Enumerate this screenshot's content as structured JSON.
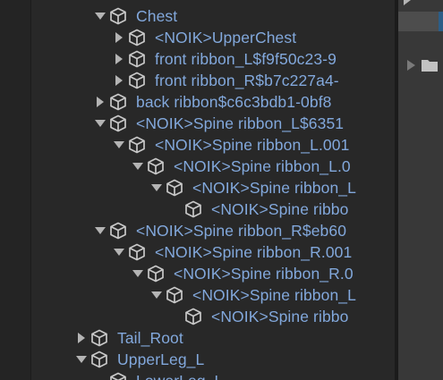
{
  "hierarchy": {
    "rows": [
      {
        "label": "Chest",
        "depth": 1,
        "arrow": "expanded"
      },
      {
        "label": "<NOIK>UpperChest",
        "depth": 2,
        "arrow": "collapsed"
      },
      {
        "label": "front ribbon_L$f9f50c23-9",
        "depth": 2,
        "arrow": "collapsed"
      },
      {
        "label": "front ribbon_R$b7c227a4-",
        "depth": 2,
        "arrow": "collapsed"
      },
      {
        "label": "back ribbon$c6c3bdb1-0bf8",
        "depth": 1,
        "arrow": "collapsed"
      },
      {
        "label": "<NOIK>Spine ribbon_L$6351",
        "depth": 1,
        "arrow": "expanded"
      },
      {
        "label": "<NOIK>Spine ribbon_L.001",
        "depth": 2,
        "arrow": "expanded"
      },
      {
        "label": "<NOIK>Spine ribbon_L.0",
        "depth": 3,
        "arrow": "expanded"
      },
      {
        "label": "<NOIK>Spine ribbon_L",
        "depth": 4,
        "arrow": "expanded"
      },
      {
        "label": "<NOIK>Spine ribbo",
        "depth": 5,
        "arrow": "none"
      },
      {
        "label": "<NOIK>Spine ribbon_R$eb60",
        "depth": 1,
        "arrow": "expanded"
      },
      {
        "label": "<NOIK>Spine ribbon_R.001",
        "depth": 2,
        "arrow": "expanded"
      },
      {
        "label": "<NOIK>Spine ribbon_R.0",
        "depth": 3,
        "arrow": "expanded"
      },
      {
        "label": "<NOIK>Spine ribbon_L",
        "depth": 4,
        "arrow": "expanded"
      },
      {
        "label": "<NOIK>Spine ribbo",
        "depth": 5,
        "arrow": "none"
      },
      {
        "label": "Tail_Root",
        "depth": 0,
        "arrow": "collapsed"
      },
      {
        "label": "UpperLeg_L",
        "depth": 0,
        "arrow": "expanded"
      },
      {
        "label": "LowerLeg_L",
        "depth": 1,
        "arrow": "none"
      }
    ]
  },
  "colors": {
    "label": "#82a8dc",
    "arrow": "#b4b4b4",
    "cube": "#c8c8c8",
    "background": "#282828",
    "right_panel": "#383838",
    "selected_row": "#4d4d4d",
    "selection_accent": "#2c5d87"
  },
  "icons": {
    "row_icon": "gameobject-cube-icon",
    "expanded_arrow": "chevron-down-icon",
    "collapsed_arrow": "chevron-right-icon",
    "right_panel_item": "folder-icon"
  }
}
